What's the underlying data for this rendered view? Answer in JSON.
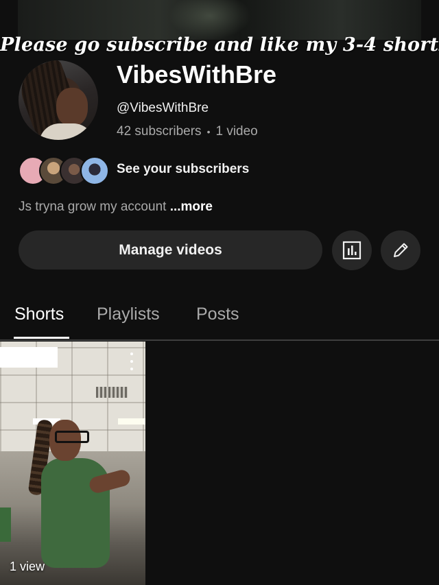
{
  "overlay": {
    "caption": "Please go subscribe and like my 3-4 shorts"
  },
  "channel": {
    "name": "VibesWithBre",
    "handle": "@VibesWithBre",
    "subscribers": "42 subscribers",
    "separator": "•",
    "videos": "1 video",
    "see_subscribers": "See your subscribers",
    "description": "Js tryna grow my account",
    "more_label": "...more"
  },
  "actions": {
    "manage_label": "Manage videos",
    "analytics_icon": "analytics-icon",
    "edit_icon": "pencil-icon"
  },
  "tabs": [
    {
      "label": "Shorts",
      "active": true
    },
    {
      "label": "Playlists",
      "active": false
    },
    {
      "label": "Posts",
      "active": false
    }
  ],
  "shorts": [
    {
      "views": "1 view",
      "menu_icon": "kebab-icon"
    }
  ],
  "colors": {
    "background": "#0f0f0f",
    "button": "#272727",
    "muted_text": "#aaaaaa"
  }
}
